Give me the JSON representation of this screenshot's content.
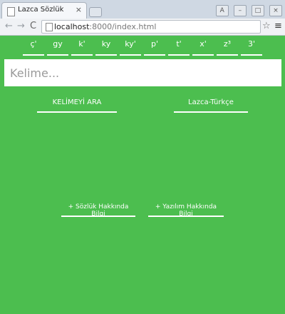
{
  "browser": {
    "tab_title": "Lazca Sözlük",
    "tab_close": "×",
    "url_host": "localhost",
    "url_rest": ":8000/index.html",
    "back": "←",
    "forward": "→",
    "reload": "C",
    "star": "☆",
    "menu": "≡",
    "win_controls": [
      "A",
      "–",
      "□",
      "×"
    ]
  },
  "letters": [
    "ç'",
    "gy",
    "k'",
    "ky",
    "ky'",
    "p'",
    "t'",
    "x'",
    "z³",
    "3'"
  ],
  "search": {
    "placeholder": "Kelime..."
  },
  "buttons": {
    "search_word": "KELİMEYİ ARA",
    "language": "Lazca-Türkçe",
    "dictionary_info": "+ Sözlük Hakkında Bilgi",
    "software_info": "+ Yazılım Hakkında Bilgi"
  },
  "colors": {
    "background": "#4cbe4f",
    "text": "#ffffff"
  }
}
